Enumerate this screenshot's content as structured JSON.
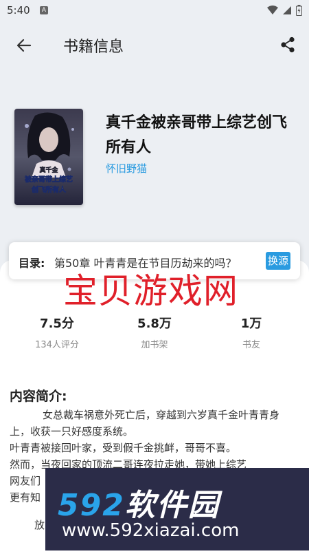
{
  "status_bar": {
    "time": "5:40",
    "app_badge": "A"
  },
  "app_bar": {
    "title": "书籍信息",
    "back_icon": "arrow-left-icon",
    "share_icon": "share-icon"
  },
  "book": {
    "title": "真千金被亲哥带上综艺创飞所有人",
    "author": "怀旧野猫",
    "cover_text": [
      "真千金",
      "被亲哥带上综艺",
      "创飞所有人"
    ]
  },
  "toc": {
    "label": "目录:",
    "chapter": "第50章 叶青青是在节目历劫来的吗？",
    "switch_label": "换源"
  },
  "watermark": "宝贝游戏网",
  "stats": [
    {
      "value": "7.5分",
      "label": "134人评分"
    },
    {
      "value": "5.8万",
      "label": "加书架"
    },
    {
      "value": "1万",
      "label": "书友"
    }
  ],
  "intro": {
    "heading": "内容简介:",
    "paragraphs": [
      "女总裁车祸意外死亡后，穿越到六岁真千金叶青青身上，收获一只好感度系统。",
      "叶青青被接回叶家，受到假千金挑衅，哥哥不喜。",
      "然而，当夜回家的顶流二哥连夜拉走她，带她上综艺",
      "网友们",
      "更有知",
      "放"
    ]
  },
  "banner": {
    "logo_num": "592",
    "logo_text": "软件园",
    "url": "www.592xiazai.com"
  }
}
